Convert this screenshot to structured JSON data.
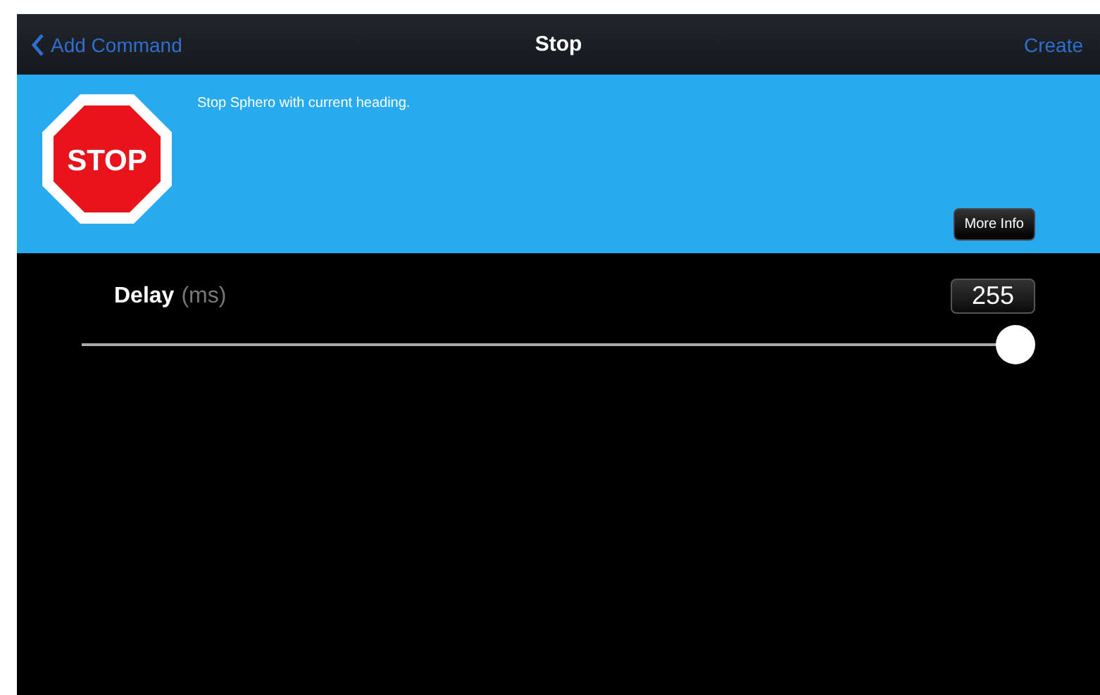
{
  "nav_bar": {
    "back": "Add Command",
    "title": "Stop",
    "action": "Create"
  },
  "info": {
    "sign_text": "STOP",
    "description": "Stop Sphero with current heading.",
    "more_button": "More Info"
  },
  "delay": {
    "label": "Delay",
    "unit": "(ms)",
    "value": "255",
    "level": 1.0
  }
}
